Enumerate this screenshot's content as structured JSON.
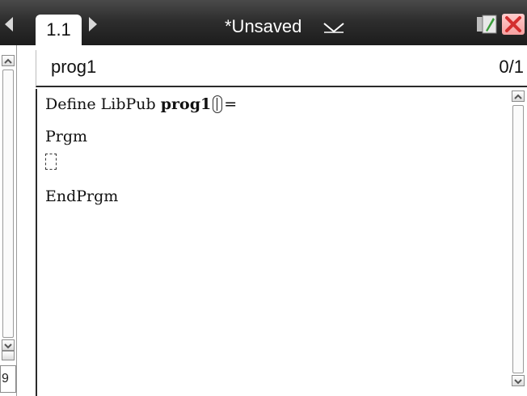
{
  "topbar": {
    "tab_label": "1.1",
    "document_title": "*Unsaved"
  },
  "program": {
    "name": "prog1",
    "position": "0/1"
  },
  "code": {
    "line1_define": "Define LibPub ",
    "line1_name": "prog1",
    "line1_equals": "=",
    "line2": "Prgm",
    "line4": "EndPrgm"
  },
  "gutter": {
    "line_number": "9"
  },
  "icons": {
    "prev_page": "left-triangle-icon",
    "next_page": "right-triangle-icon",
    "title_menu": "chevron-down-icon",
    "battery": "battery-icon",
    "close": "close-icon"
  },
  "colors": {
    "titlebar": "#2e2e2e",
    "close_x": "#d32f2f",
    "battery_fill": "#3a9e3a"
  }
}
